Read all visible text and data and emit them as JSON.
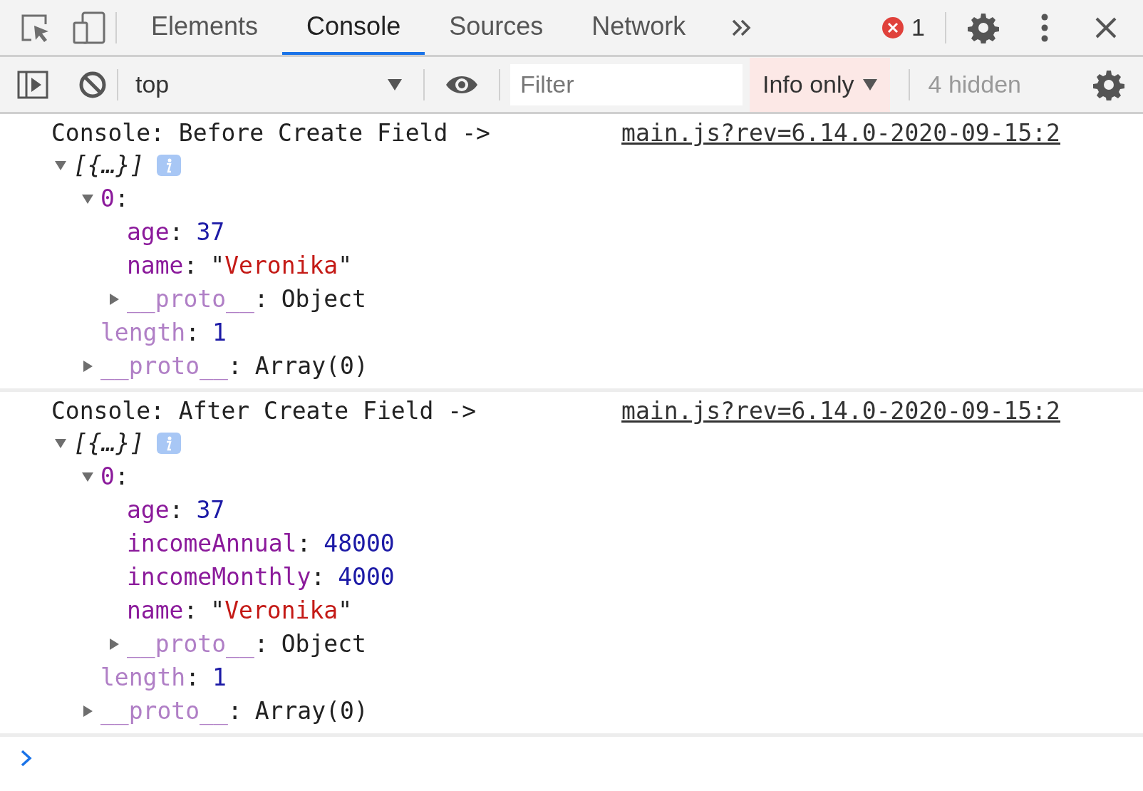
{
  "tabs": [
    {
      "label": "Elements",
      "selected": false
    },
    {
      "label": "Console",
      "selected": true
    },
    {
      "label": "Sources",
      "selected": false
    },
    {
      "label": "Network",
      "selected": false
    }
  ],
  "error_count": "1",
  "console_toolbar": {
    "context": "top",
    "filter": {
      "placeholder": "Filter"
    },
    "levels": "Info only",
    "hidden": "4 hidden"
  },
  "messages": [
    {
      "text": "Console: Before Create Field ->",
      "source": "main.js?rev=6.14.0-2020-09-15:2",
      "tree": {
        "preview": "[{…}]",
        "expanded": true,
        "children": [
          {
            "key": "0:",
            "inherited": false,
            "expanded": true,
            "children": [
              {
                "key": "age:",
                "inherited": false,
                "value": "37",
                "kind": "number"
              },
              {
                "key": "name:",
                "inherited": false,
                "value": "\"Veronika\"",
                "kind": "string"
              },
              {
                "key": "__proto__:",
                "inherited": true,
                "value": "Object",
                "kind": "object",
                "expanded": false
              }
            ]
          },
          {
            "key": "length:",
            "inherited": true,
            "value": "1",
            "kind": "number"
          },
          {
            "key": "__proto__:",
            "inherited": true,
            "value": "Array(0)",
            "kind": "object",
            "expanded": false
          }
        ]
      }
    },
    {
      "text": "Console: After Create Field ->",
      "source": "main.js?rev=6.14.0-2020-09-15:2",
      "tree": {
        "preview": "[{…}]",
        "expanded": true,
        "children": [
          {
            "key": "0:",
            "inherited": false,
            "expanded": true,
            "children": [
              {
                "key": "age:",
                "inherited": false,
                "value": "37",
                "kind": "number"
              },
              {
                "key": "incomeAnnual:",
                "inherited": false,
                "value": "48000",
                "kind": "number"
              },
              {
                "key": "incomeMonthly:",
                "inherited": false,
                "value": "4000",
                "kind": "number"
              },
              {
                "key": "name:",
                "inherited": false,
                "value": "\"Veronika\"",
                "kind": "string"
              },
              {
                "key": "__proto__:",
                "inherited": true,
                "value": "Object",
                "kind": "object",
                "expanded": false
              }
            ]
          },
          {
            "key": "length:",
            "inherited": true,
            "value": "1",
            "kind": "number"
          },
          {
            "key": "__proto__:",
            "inherited": true,
            "value": "Array(0)",
            "kind": "object",
            "expanded": false
          }
        ]
      }
    }
  ]
}
